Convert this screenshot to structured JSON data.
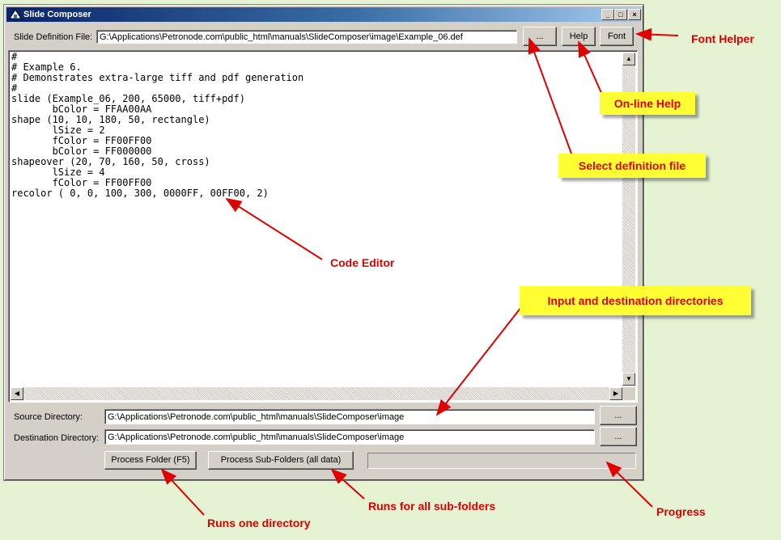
{
  "window": {
    "title": "Slide Composer",
    "controls": {
      "minimize": "_",
      "maximize": "□",
      "close": "×"
    }
  },
  "definition": {
    "label": "Slide Definition File:",
    "value": "G:\\Applications\\Petronode.com\\public_html\\manuals\\SlideComposer\\image\\Example_06.def",
    "browse_label": "...",
    "help_label": "Help",
    "font_label": "Font"
  },
  "editor": {
    "code": "#\n# Example 6.\n# Demonstrates extra-large tiff and pdf generation\n#\nslide (Example_06, 200, 65000, tiff+pdf)\n       bColor = FFAA00AA\nshape (10, 10, 180, 50, rectangle)\n       lSize = 2\n       fColor = FF00FF00\n       bColor = FF000000\nshapeover (20, 70, 160, 50, cross)\n       lSize = 4\n       fColor = FF00FF00\nrecolor ( 0, 0, 100, 300, 0000FF, 00FF00, 2)"
  },
  "source": {
    "label": "Source Directory:",
    "value": "G:\\Applications\\Petronode.com\\public_html\\manuals\\SlideComposer\\image",
    "browse_label": "..."
  },
  "destination": {
    "label": "Destination Directory:",
    "value": "G:\\Applications\\Petronode.com\\public_html\\manuals\\SlideComposer\\image",
    "browse_label": "..."
  },
  "actions": {
    "process_folder": "Process Folder (F5)",
    "process_subfolders": "Process Sub-Folders (all data)"
  },
  "progress": {
    "value": 0
  },
  "annotations": {
    "font_helper": "Font Helper",
    "online_help": "On-line Help",
    "select_definition": "Select definition file",
    "code_editor": "Code Editor",
    "directories": "Input and destination directories",
    "runs_one": "Runs one directory",
    "runs_all": "Runs for all sub-folders",
    "progress": "Progress"
  },
  "colors": {
    "background": "#e5f3d3",
    "callout_fill": "#ffff33",
    "annotation_red": "#e00000",
    "title_bar": "#0a246a"
  }
}
